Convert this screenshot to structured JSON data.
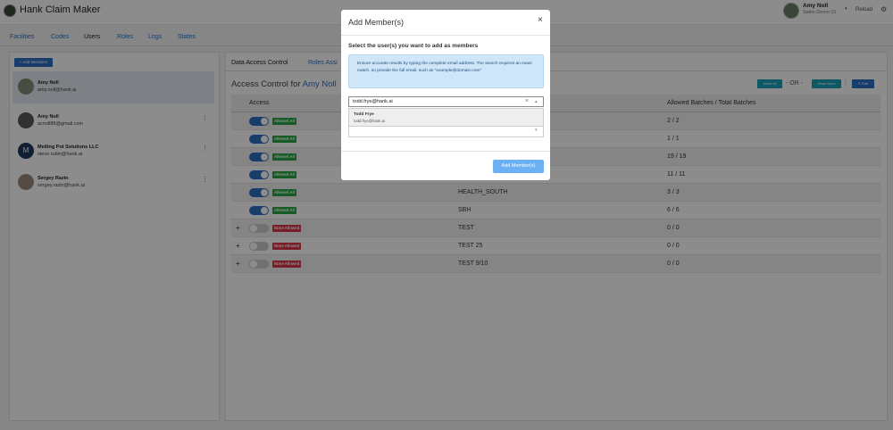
{
  "app": {
    "title": "Hank Claim Maker"
  },
  "header": {
    "user_name": "Amy Noll",
    "user_org": "Sales Demo 01",
    "user_caret": "▾",
    "reload": "Reload",
    "settings_icon": "gear-icon"
  },
  "nav": {
    "tabs": [
      {
        "label": "Facilities"
      },
      {
        "label": "Codes"
      },
      {
        "label": "Users"
      },
      {
        "label": "Roles"
      },
      {
        "label": "Logs"
      },
      {
        "label": "States"
      }
    ]
  },
  "left": {
    "add_members": "+ Add Members",
    "members": [
      {
        "name": "Amy Noll",
        "email": "amy.noll@hank.ai"
      },
      {
        "name": "Amy Noll",
        "email": "acnoll88@gmail.com"
      },
      {
        "name": "Melting Pot Solutions LLC",
        "email": "steve.rubin@hank.ai",
        "initial": "M"
      },
      {
        "name": "Sergey Razin",
        "email": "sergey.razin@hank.ai"
      }
    ],
    "menu_glyph": "⋮"
  },
  "right": {
    "tabs": [
      {
        "label": "Data Access Control"
      },
      {
        "label": "Roles Assi"
      }
    ],
    "access_prefix": "Access Control for",
    "access_user": "Amy Noll",
    "allow_all": "Allow All",
    "or_text": "- OR -",
    "allow_none": "Allow None",
    "pipe": "|",
    "edit": "Edit",
    "edit_icon": "edit-icon",
    "columns": {
      "access": "Access",
      "batches": "Allowed Batches / Total Batches"
    },
    "rows": [
      {
        "allowed": true,
        "badge": "Allowed All",
        "facility": "",
        "batches": "2 / 2",
        "plus": ""
      },
      {
        "allowed": true,
        "badge": "Allowed All",
        "facility": "",
        "batches": "1 / 1",
        "plus": ""
      },
      {
        "allowed": true,
        "badge": "Allowed All",
        "facility": "",
        "batches": "19 / 19",
        "plus": ""
      },
      {
        "allowed": true,
        "badge": "Allowed All",
        "facility": "",
        "batches": "11 / 11",
        "plus": ""
      },
      {
        "allowed": true,
        "badge": "Allowed All",
        "facility": "HEALTH_SOUTH",
        "batches": "3 / 3",
        "plus": ""
      },
      {
        "allowed": true,
        "badge": "Allowed All",
        "facility": "SBH",
        "batches": "6 / 6",
        "plus": ""
      },
      {
        "allowed": false,
        "badge": "None Allowed",
        "facility": "TEST",
        "batches": "0 / 0",
        "plus": "+"
      },
      {
        "allowed": false,
        "badge": "None Allowed",
        "facility": "TEST 25",
        "batches": "0 / 0",
        "plus": "+"
      },
      {
        "allowed": false,
        "badge": "None Allowed",
        "facility": "TEST 9/10",
        "batches": "0 / 0",
        "plus": "+"
      }
    ]
  },
  "modal": {
    "title": "Add Member(s)",
    "close": "×",
    "label": "Select the user(s) you want to add as members",
    "info": "Ensure accurate results by typing the complete email address. The search requires an exact match, so provide the full email, such as \"example@domain.com\"",
    "search_value": "todd.frye@hank.ai",
    "clear_glyph": "×",
    "caret_glyph": "▾",
    "option": {
      "name": "Todd Frye",
      "email": "todd.frye@hank.ai"
    },
    "submit": "Add Member(s)"
  },
  "colors": {
    "primary": "#2d6fc4",
    "teal": "#17a2b8",
    "success": "#28a745",
    "danger": "#dc3545",
    "submit_disabled": "#6ab0f3",
    "info_bg": "#cfe6f8"
  }
}
